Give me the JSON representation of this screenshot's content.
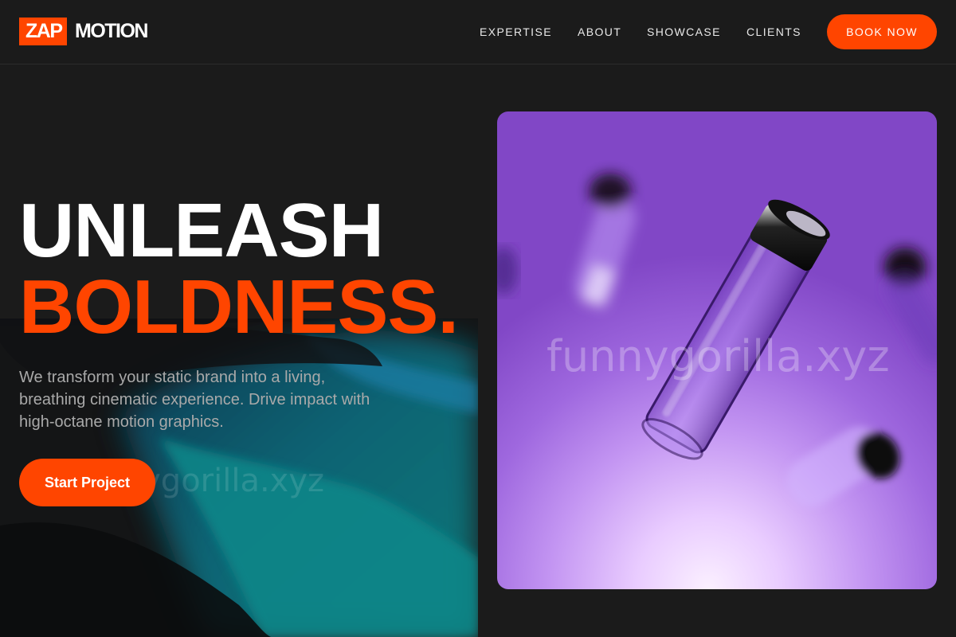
{
  "brand": {
    "logo_box": "ZAP",
    "logo_word": "MOTION",
    "accent_color": "#ff4500"
  },
  "nav": {
    "items": [
      {
        "label": "EXPERTISE"
      },
      {
        "label": "ABOUT"
      },
      {
        "label": "SHOWCASE"
      },
      {
        "label": "CLIENTS"
      }
    ],
    "cta_label": "BOOK NOW"
  },
  "hero": {
    "headline_line1": "UNLEASH",
    "headline_line2": "BOLDNESS.",
    "subtitle": "We transform your static brand into a living, breathing cinematic experience. Drive impact with high-octane motion graphics.",
    "cta_label": "Start Project"
  },
  "watermarks": {
    "left": "funnygorilla.xyz",
    "card": "funnygorilla.xyz"
  },
  "icons": {
    "hero_image": "floating-glass-vials-image",
    "fluid_art": "teal-fluid-wave-art"
  }
}
